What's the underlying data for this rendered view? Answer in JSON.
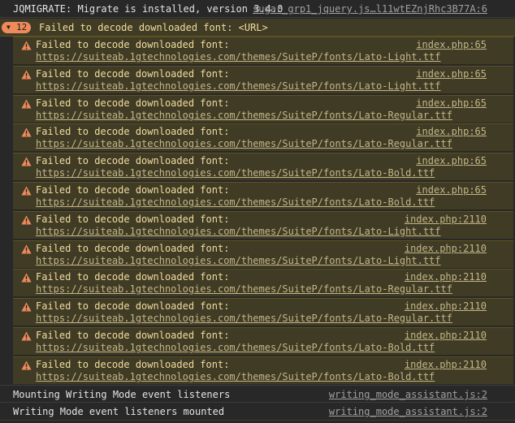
{
  "console": {
    "top_message": {
      "text": "JQMIGRATE: Migrate is installed, version 3.4.0",
      "source": "sugar_grp1_jquery.js…l11wtEZnjRhc3B77A:6"
    },
    "group": {
      "count": "12",
      "message": "Failed to decode downloaded font: <URL>"
    },
    "warnings": [
      {
        "text": "Failed to decode downloaded font:",
        "url": "https://suiteab.1gtechnologies.com/themes/SuiteP/fonts/Lato-Light.ttf",
        "source": "index.php:65"
      },
      {
        "text": "Failed to decode downloaded font:",
        "url": "https://suiteab.1gtechnologies.com/themes/SuiteP/fonts/Lato-Light.ttf",
        "source": "index.php:65"
      },
      {
        "text": "Failed to decode downloaded font:",
        "url": "https://suiteab.1gtechnologies.com/themes/SuiteP/fonts/Lato-Regular.ttf",
        "source": "index.php:65"
      },
      {
        "text": "Failed to decode downloaded font:",
        "url": "https://suiteab.1gtechnologies.com/themes/SuiteP/fonts/Lato-Regular.ttf",
        "source": "index.php:65"
      },
      {
        "text": "Failed to decode downloaded font:",
        "url": "https://suiteab.1gtechnologies.com/themes/SuiteP/fonts/Lato-Bold.ttf",
        "source": "index.php:65"
      },
      {
        "text": "Failed to decode downloaded font:",
        "url": "https://suiteab.1gtechnologies.com/themes/SuiteP/fonts/Lato-Bold.ttf",
        "source": "index.php:65"
      },
      {
        "text": "Failed to decode downloaded font:",
        "url": "https://suiteab.1gtechnologies.com/themes/SuiteP/fonts/Lato-Light.ttf",
        "source": "index.php:2110"
      },
      {
        "text": "Failed to decode downloaded font:",
        "url": "https://suiteab.1gtechnologies.com/themes/SuiteP/fonts/Lato-Light.ttf",
        "source": "index.php:2110"
      },
      {
        "text": "Failed to decode downloaded font:",
        "url": "https://suiteab.1gtechnologies.com/themes/SuiteP/fonts/Lato-Regular.ttf",
        "source": "index.php:2110"
      },
      {
        "text": "Failed to decode downloaded font:",
        "url": "https://suiteab.1gtechnologies.com/themes/SuiteP/fonts/Lato-Regular.ttf",
        "source": "index.php:2110"
      },
      {
        "text": "Failed to decode downloaded font:",
        "url": "https://suiteab.1gtechnologies.com/themes/SuiteP/fonts/Lato-Bold.ttf",
        "source": "index.php:2110"
      },
      {
        "text": "Failed to decode downloaded font:",
        "url": "https://suiteab.1gtechnologies.com/themes/SuiteP/fonts/Lato-Bold.ttf",
        "source": "index.php:2110"
      }
    ],
    "bottom_messages": [
      {
        "text": "Mounting Writing Mode event listeners",
        "source": "writing_mode_assistant.js:2"
      },
      {
        "text": "Writing Mode event listeners mounted",
        "source": "writing_mode_assistant.js:2"
      }
    ],
    "colors": {
      "background": "#282828",
      "warning_background": "#403b25",
      "warning_text": "#f2dd9f",
      "badge": "#ee8a5b"
    }
  }
}
